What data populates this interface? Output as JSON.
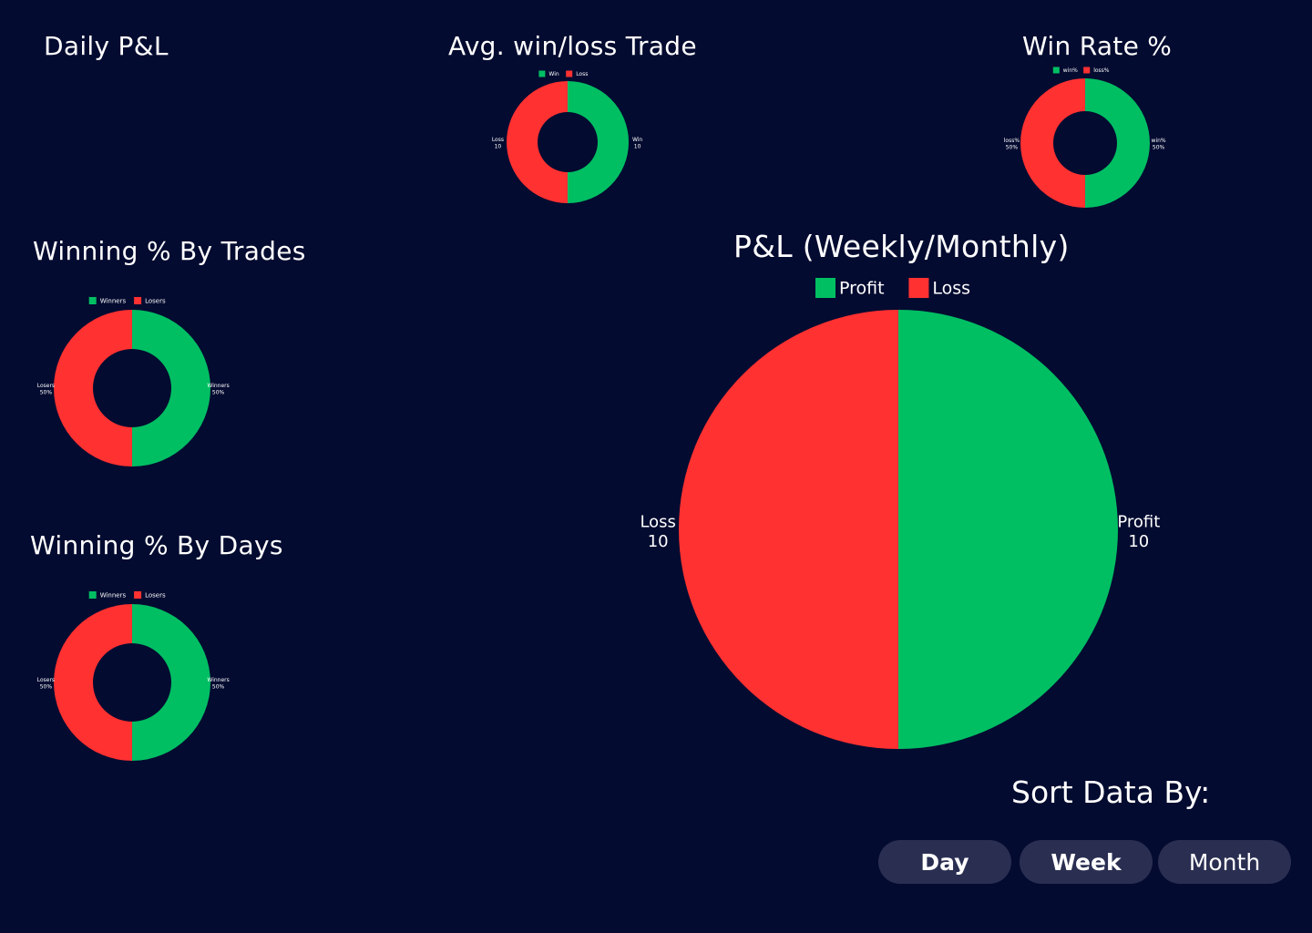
{
  "headings": {
    "daily_pnl": "Daily P&L",
    "avg_win_loss": "Avg. win/loss Trade",
    "win_rate": "Win Rate %",
    "winning_by_trades": "Winning  % By Trades",
    "pnl_weekly_monthly": "P&L (Weekly/Monthly)",
    "winning_by_days": "Winning % By Days"
  },
  "sort": {
    "label": "Sort Data By:",
    "buttons": [
      "Day",
      "Week",
      "Month"
    ]
  },
  "colors": {
    "background": "#040b30",
    "win": "#00bf63",
    "loss": "#ff3131",
    "button": "#2a2f52"
  },
  "chart_data": [
    {
      "type": "pie",
      "variant": "donut",
      "legend": "top",
      "slices": [
        {
          "label": "Win",
          "value": 10,
          "display": "10"
        },
        {
          "label": "Loss",
          "value": 10,
          "display": "10"
        }
      ]
    },
    {
      "type": "pie",
      "variant": "donut",
      "legend": "top",
      "slices": [
        {
          "label": "win%",
          "value": 50,
          "display": "50%"
        },
        {
          "label": "loss%",
          "value": 50,
          "display": "50%"
        }
      ]
    },
    {
      "type": "pie",
      "variant": "donut",
      "legend": "top",
      "slices": [
        {
          "label": "Winners",
          "value": 50,
          "display": "50%"
        },
        {
          "label": "Losers",
          "value": 50,
          "display": "50%"
        }
      ]
    },
    {
      "type": "pie",
      "variant": "pie",
      "legend": "top",
      "slices": [
        {
          "label": "Profit",
          "value": 10,
          "display": "10"
        },
        {
          "label": "Loss",
          "value": 10,
          "display": "10"
        }
      ]
    },
    {
      "type": "pie",
      "variant": "donut",
      "legend": "top",
      "slices": [
        {
          "label": "Winners",
          "value": 50,
          "display": "50%"
        },
        {
          "label": "Losers",
          "value": 50,
          "display": "50%"
        }
      ]
    }
  ]
}
